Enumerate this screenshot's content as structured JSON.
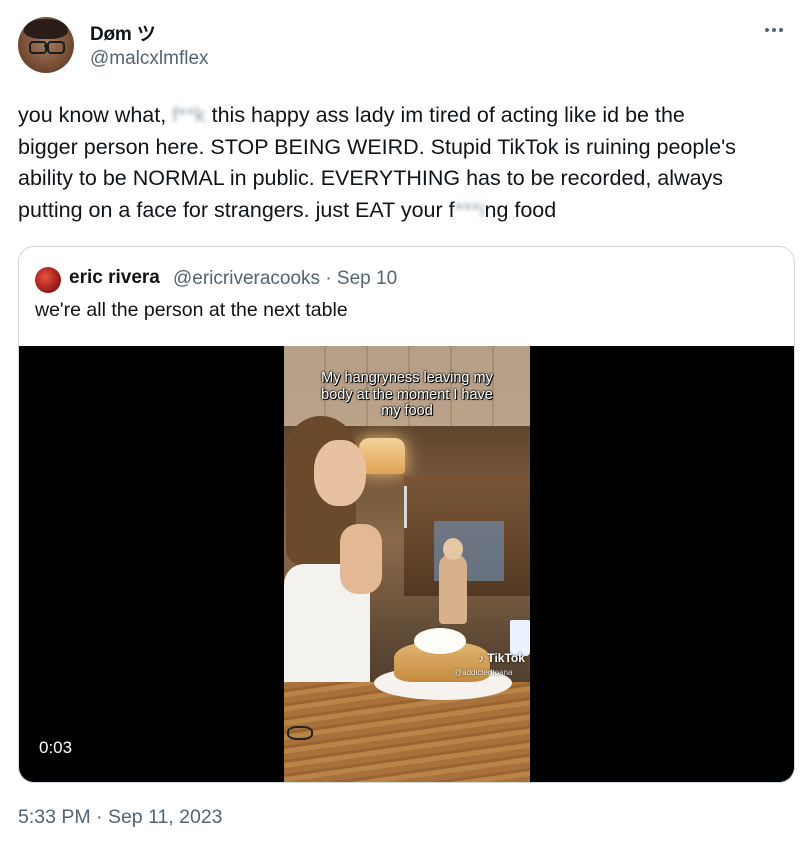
{
  "author": {
    "display_name": "Døm ツ",
    "handle": "@malcxlmflex"
  },
  "tweet": {
    "lines": [
      [
        "you know what, ",
        "f**k",
        " this happy ass lady im tired of acting like id be the"
      ],
      [
        "bigger person here. STOP BEING WEIRD. Stupid TikTok is ruining people's"
      ],
      [
        "ability to be NORMAL in public. EVERYTHING has to be recorded, always"
      ],
      [
        "putting on a face for strangers. just EAT your f",
        "***i",
        "ng food"
      ]
    ],
    "timestamp": "5:33 PM · Sep 11, 2023"
  },
  "quote": {
    "name": "eric rivera",
    "handle_date": "@ericriveracooks · Sep 10",
    "text": "we're all the person at the next table",
    "video": {
      "caption_lines": [
        "My hangryness leaving my",
        "body at the moment I have",
        "my food"
      ],
      "watermark": "TikTok",
      "watermark_user": "@addictedtoana",
      "duration": "0:03"
    }
  },
  "colors": {
    "text": "#0f1419",
    "secondary": "#536471",
    "border": "#cfd9de"
  },
  "icons": {
    "more": "more-horizontal-icon"
  }
}
